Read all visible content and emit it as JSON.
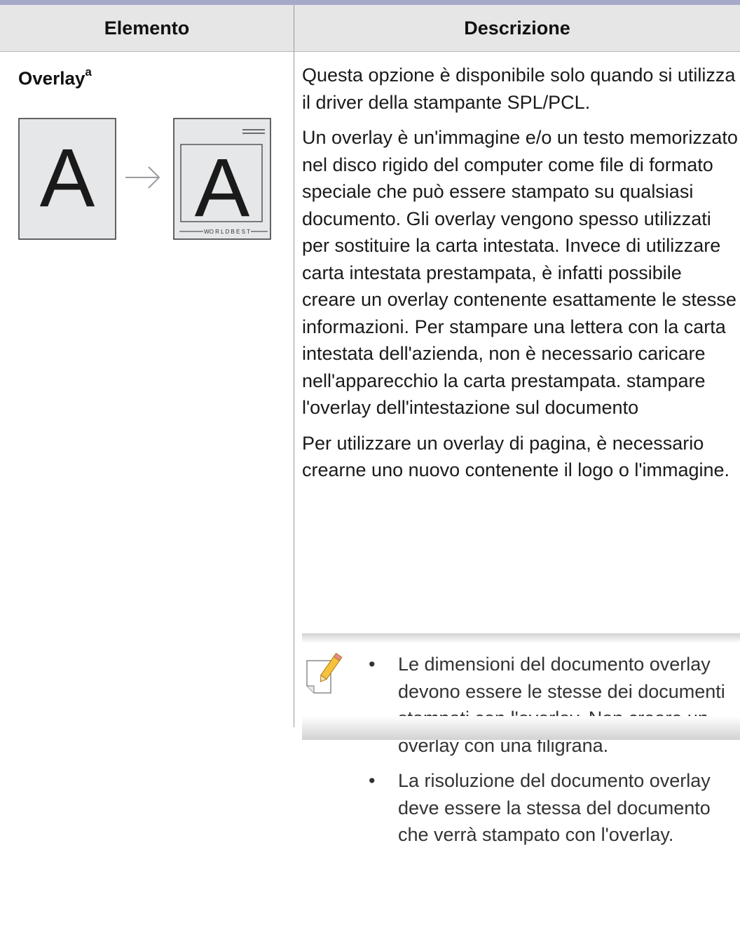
{
  "table": {
    "headers": [
      "Elemento",
      "Descrizione"
    ],
    "rows": [
      {
        "item_name": "Overlay",
        "item_name_sup": "a",
        "illustration": {
          "before_letter": "A",
          "after_letter": "A",
          "footer_text": "WO R L D  B E S T",
          "arrow": "arrow-right-icon"
        },
        "description": [
          "Questa opzione è disponibile solo quando si utilizza il driver della stampante SPL/PCL.",
          "Un overlay è un'immagine e/o un testo memorizzato nel disco rigido del computer come file di formato speciale che può essere stampato su qualsiasi documento. Gli overlay vengono spesso utilizzati per sostituire la carta intestata. Invece di utilizzare carta intestata prestampata, è infatti possibile creare un overlay contenente esattamente le stesse informazioni. Per stampare una lettera con la carta intestata dell'azienda, non è necessario caricare nell'apparecchio la carta prestampata. stampare l'overlay dell'intestazione sul documento",
          "Per utilizzare un overlay di pagina, è necessario crearne uno nuovo contenente il logo o l'immagine."
        ],
        "note": {
          "icon": "note-pencil-icon",
          "bullets": [
            "Le dimensioni del documento overlay devono essere le stesse dei documenti stampati con l'overlay. Non creare un overlay con una filigrana.",
            "La risoluzione del documento overlay deve essere la stessa del documento che verrà stampato con l'overlay."
          ]
        }
      }
    ]
  }
}
